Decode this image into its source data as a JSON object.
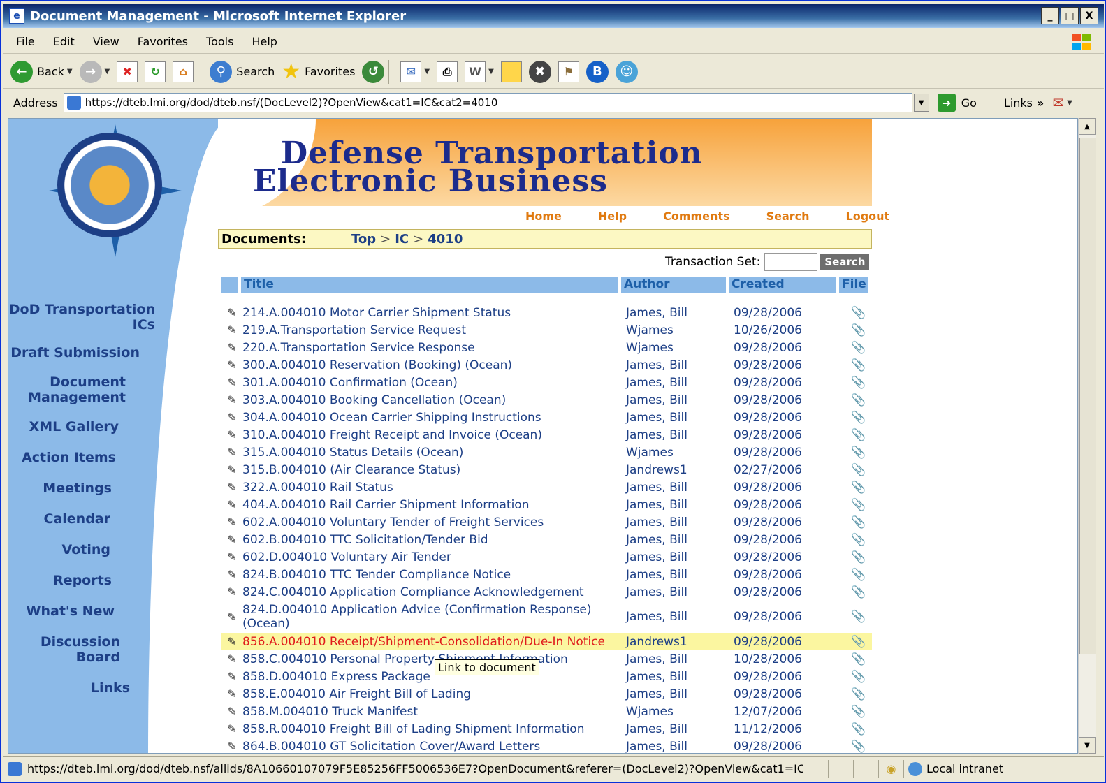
{
  "window": {
    "title": "Document Management - Microsoft Internet Explorer",
    "buttons": [
      "_",
      "□",
      "X"
    ]
  },
  "menu": [
    "File",
    "Edit",
    "View",
    "Favorites",
    "Tools",
    "Help"
  ],
  "toolbar": {
    "back": "Back",
    "search": "Search",
    "favorites": "Favorites"
  },
  "address": {
    "label": "Address",
    "url": "https://dteb.lmi.org/dod/dteb.nsf/(DocLevel2)?OpenView&cat1=IC&cat2=4010",
    "go": "Go",
    "links": "Links"
  },
  "site": {
    "banner_line1": "Defense Transportation",
    "banner_line2": "Electronic Business",
    "nav": [
      "DoD Transportation ICs",
      "Draft Submission",
      "Document Management",
      "XML Gallery",
      "Action Items",
      "Meetings",
      "Calendar",
      "Voting",
      "Reports",
      "What's New",
      "Discussion Board",
      "Links"
    ],
    "toplinks": [
      "Home",
      "Help",
      "Comments",
      "Search",
      "Logout"
    ],
    "breadcrumb": {
      "label": "Documents:",
      "items": [
        "Top",
        "IC",
        "4010"
      ]
    },
    "txset": {
      "label": "Transaction Set:",
      "button": "Search"
    },
    "columns": [
      "Title",
      "Author",
      "Created",
      "File"
    ],
    "tooltip": "Link to document"
  },
  "documents": [
    {
      "title": "214.A.004010 Motor Carrier Shipment Status",
      "author": "James, Bill",
      "created": "09/28/2006"
    },
    {
      "title": "219.A.Transportation Service Request",
      "author": "Wjames",
      "created": "10/26/2006"
    },
    {
      "title": "220.A.Transportation Service Response",
      "author": "Wjames",
      "created": "09/28/2006"
    },
    {
      "title": "300.A.004010 Reservation (Booking) (Ocean)",
      "author": "James, Bill",
      "created": "09/28/2006"
    },
    {
      "title": "301.A.004010 Confirmation (Ocean)",
      "author": "James, Bill",
      "created": "09/28/2006"
    },
    {
      "title": "303.A.004010 Booking Cancellation (Ocean)",
      "author": "James, Bill",
      "created": "09/28/2006"
    },
    {
      "title": "304.A.004010 Ocean Carrier Shipping Instructions",
      "author": "James, Bill",
      "created": "09/28/2006"
    },
    {
      "title": "310.A.004010 Freight Receipt and Invoice (Ocean)",
      "author": "James, Bill",
      "created": "09/28/2006"
    },
    {
      "title": "315.A.004010 Status Details (Ocean)",
      "author": "Wjames",
      "created": "09/28/2006"
    },
    {
      "title": "315.B.004010 (Air Clearance Status)",
      "author": "Jandrews1",
      "created": "02/27/2006"
    },
    {
      "title": "322.A.004010 Rail Status",
      "author": "James, Bill",
      "created": "09/28/2006"
    },
    {
      "title": "404.A.004010 Rail Carrier Shipment Information",
      "author": "James, Bill",
      "created": "09/28/2006"
    },
    {
      "title": "602.A.004010 Voluntary Tender of Freight Services",
      "author": "James, Bill",
      "created": "09/28/2006"
    },
    {
      "title": "602.B.004010 TTC Solicitation/Tender Bid",
      "author": "James, Bill",
      "created": "09/28/2006"
    },
    {
      "title": "602.D.004010 Voluntary Air Tender",
      "author": "James, Bill",
      "created": "09/28/2006"
    },
    {
      "title": "824.B.004010 TTC Tender Compliance Notice",
      "author": "James, Bill",
      "created": "09/28/2006"
    },
    {
      "title": "824.C.004010 Application Compliance Acknowledgement",
      "author": "James, Bill",
      "created": "09/28/2006"
    },
    {
      "title": "824.D.004010 Application Advice (Confirmation Response) (Ocean)",
      "author": "James, Bill",
      "created": "09/28/2006"
    },
    {
      "title": "856.A.004010 Receipt/Shipment-Consolidation/Due-In Notice",
      "author": "Jandrews1",
      "created": "09/28/2006",
      "highlight": true
    },
    {
      "title": "858.C.004010 Personal Property Shipment Information",
      "author": "James, Bill",
      "created": "10/28/2006"
    },
    {
      "title": "858.D.004010 Express Package",
      "author": "James, Bill",
      "created": "09/28/2006"
    },
    {
      "title": "858.E.004010 Air Freight Bill of Lading",
      "author": "James, Bill",
      "created": "09/28/2006"
    },
    {
      "title": "858.M.004010 Truck Manifest",
      "author": "Wjames",
      "created": "12/07/2006"
    },
    {
      "title": "858.R.004010 Freight Bill of Lading Shipment Information",
      "author": "James, Bill",
      "created": "11/12/2006"
    },
    {
      "title": "864.B.004010 GT Solicitation Cover/Award Letters",
      "author": "James, Bill",
      "created": "09/28/2006"
    }
  ],
  "status": {
    "url": "https://dteb.lmi.org/dod/dteb.nsf/allids/8A10660107079F5E85256FF5006536E7?OpenDocument&referer=(DocLevel2)?OpenView&cat1=IC&cat",
    "zone": "Local intranet"
  }
}
